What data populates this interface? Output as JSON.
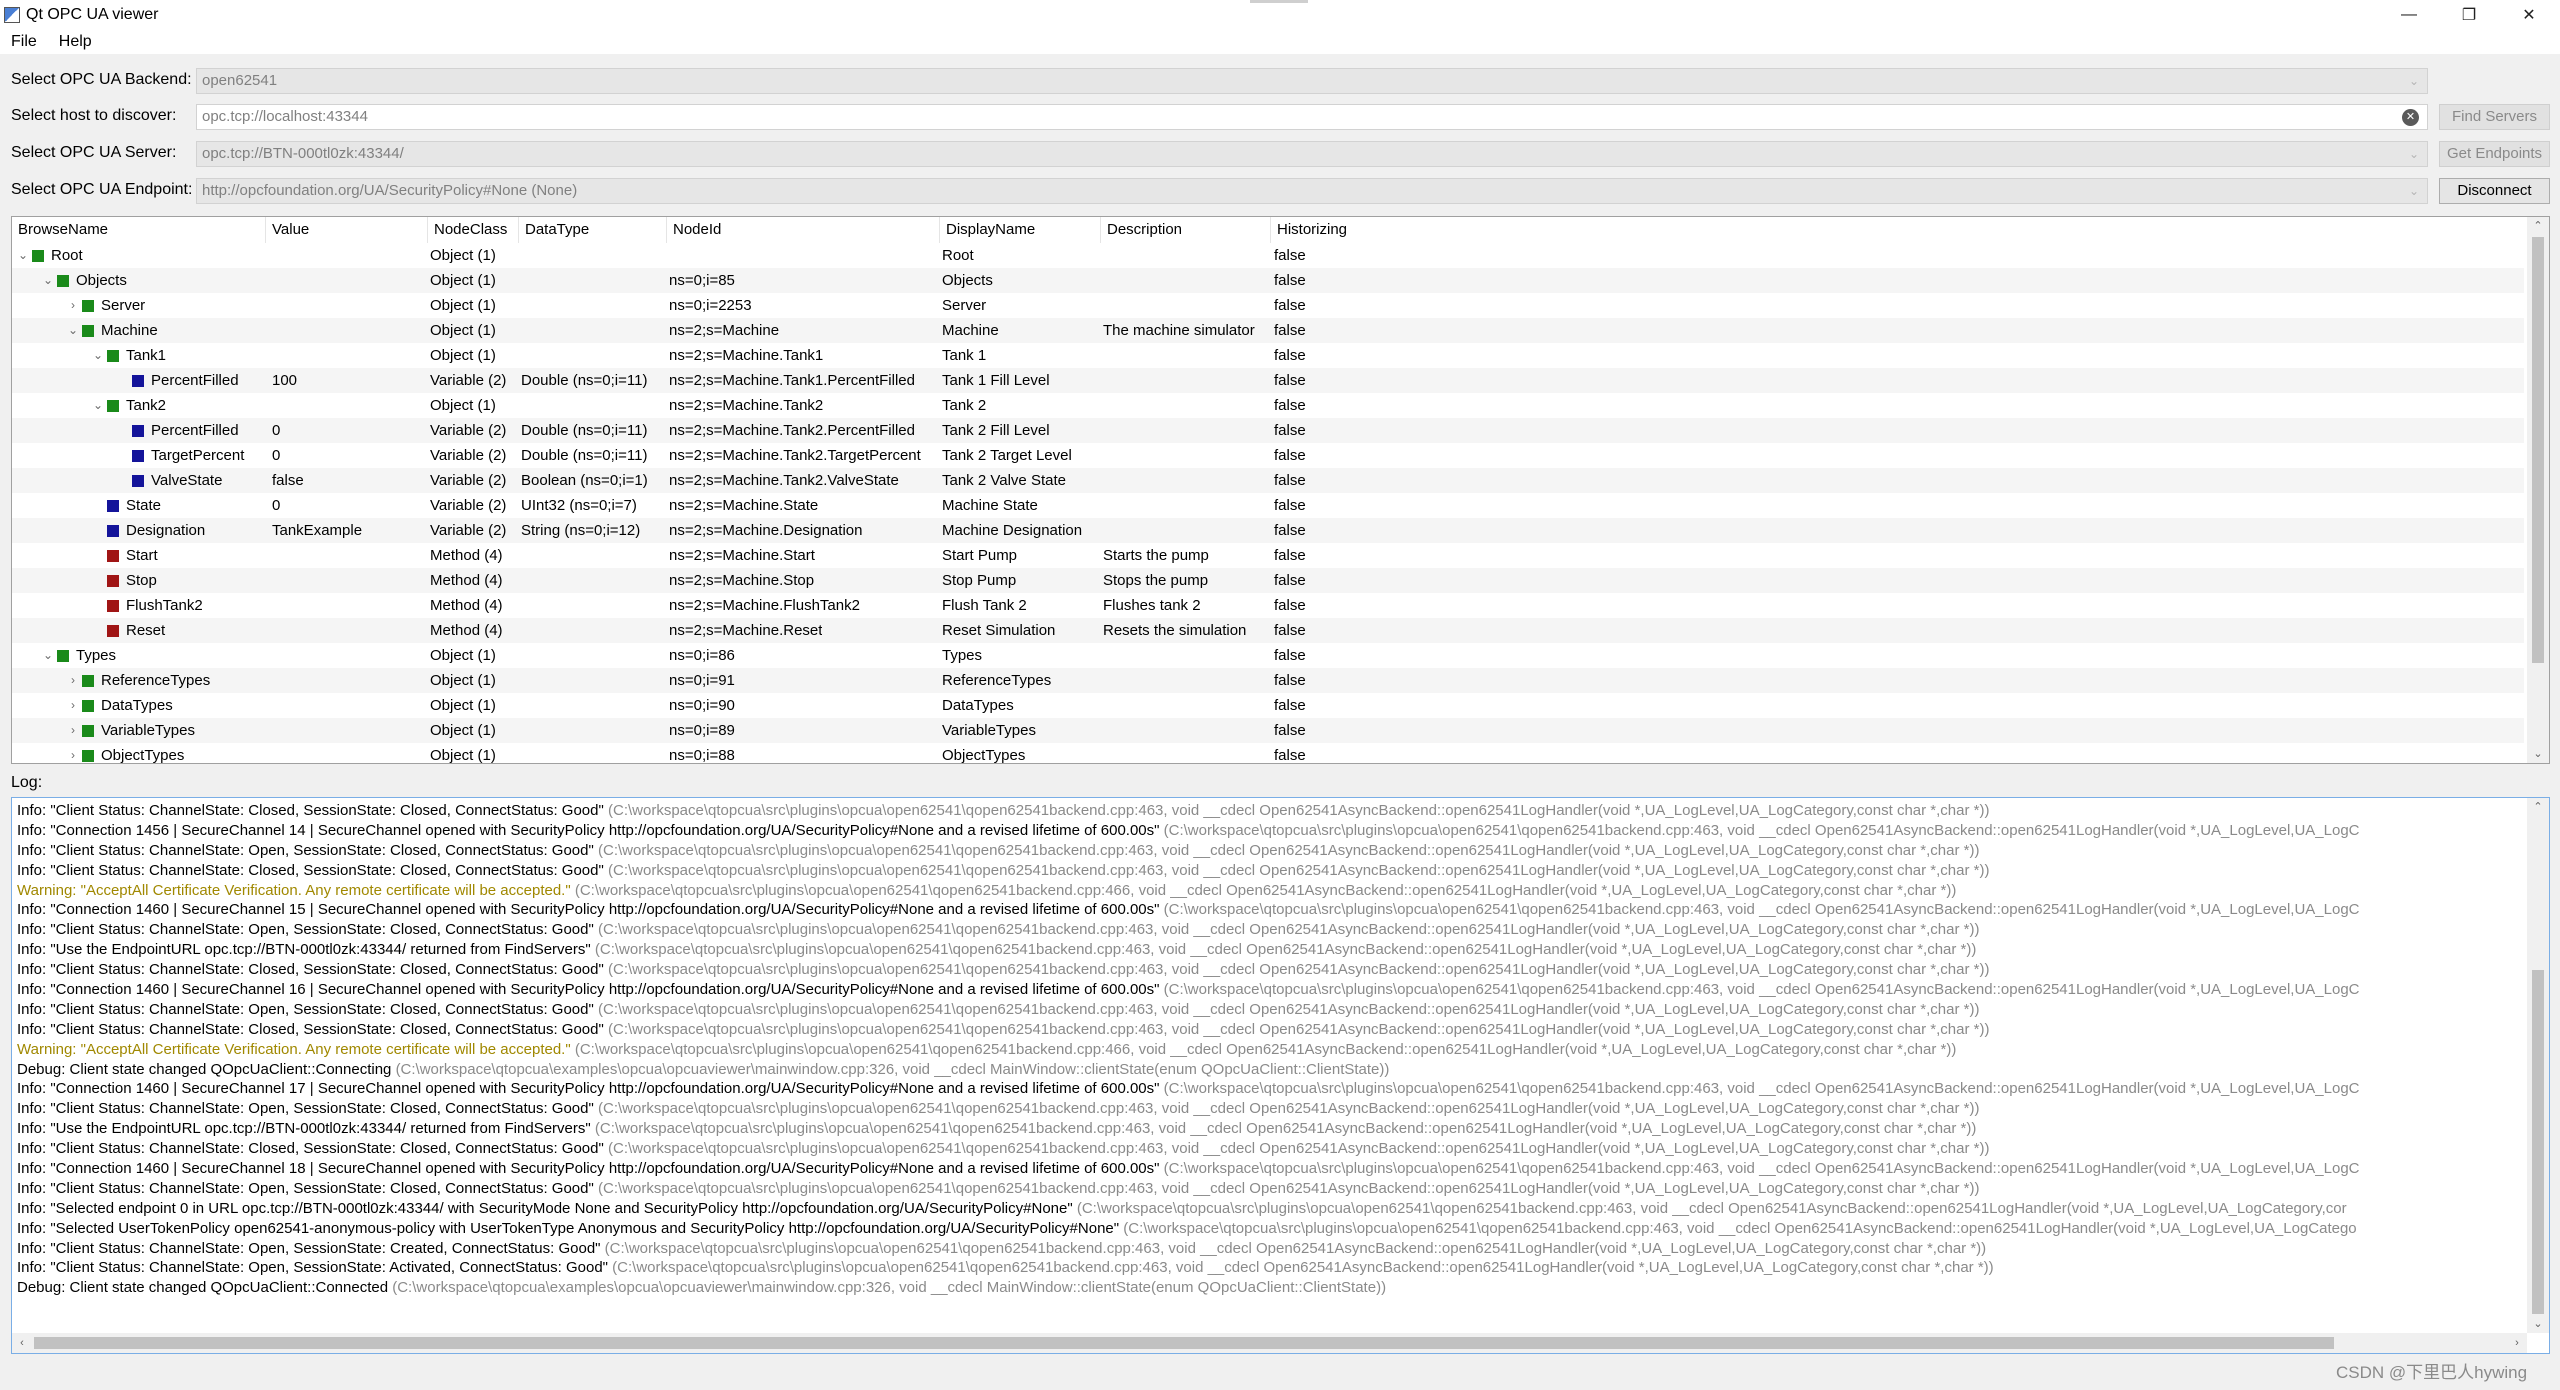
{
  "window": {
    "title": "Qt OPC UA viewer",
    "minimize": "—",
    "maximize": "❐",
    "close": "✕"
  },
  "menu": [
    "File",
    "Help"
  ],
  "form": {
    "backend_label": "Select OPC UA Backend:",
    "backend_value": "open62541",
    "host_label": "Select host to discover:",
    "host_value": "opc.tcp://localhost:43344",
    "find_servers": "Find Servers",
    "server_label": "Select OPC UA Server:",
    "server_value": "opc.tcp://BTN-000tl0zk:43344/",
    "get_endpoints": "Get Endpoints",
    "endpoint_label": "Select OPC UA Endpoint:",
    "endpoint_value": "http://opcfoundation.org/UA/SecurityPolicy#None (None)",
    "disconnect": "Disconnect"
  },
  "tree": {
    "headers": [
      "BrowseName",
      "Value",
      "NodeClass",
      "DataType",
      "NodeId",
      "DisplayName",
      "Description",
      "Historizing"
    ],
    "rows": [
      {
        "level": 0,
        "expander": "open",
        "icon": "green",
        "browse": "Root",
        "value": "",
        "nodeclass": "Object (1)",
        "datatype": "",
        "nodeid": "",
        "display": "Root",
        "desc": "",
        "hist": "false"
      },
      {
        "level": 1,
        "expander": "open",
        "icon": "green",
        "browse": "Objects",
        "value": "",
        "nodeclass": "Object (1)",
        "datatype": "",
        "nodeid": "ns=0;i=85",
        "display": "Objects",
        "desc": "",
        "hist": "false"
      },
      {
        "level": 2,
        "expander": "closed",
        "icon": "green",
        "browse": "Server",
        "value": "",
        "nodeclass": "Object (1)",
        "datatype": "",
        "nodeid": "ns=0;i=2253",
        "display": "Server",
        "desc": "",
        "hist": "false"
      },
      {
        "level": 2,
        "expander": "open",
        "icon": "green",
        "browse": "Machine",
        "value": "",
        "nodeclass": "Object (1)",
        "datatype": "",
        "nodeid": "ns=2;s=Machine",
        "display": "Machine",
        "desc": "The machine simulator",
        "hist": "false"
      },
      {
        "level": 3,
        "expander": "open",
        "icon": "green",
        "browse": "Tank1",
        "value": "",
        "nodeclass": "Object (1)",
        "datatype": "",
        "nodeid": "ns=2;s=Machine.Tank1",
        "display": "Tank 1",
        "desc": "",
        "hist": "false"
      },
      {
        "level": 4,
        "expander": "none",
        "icon": "blue",
        "browse": "PercentFilled",
        "value": "100",
        "nodeclass": "Variable (2)",
        "datatype": "Double (ns=0;i=11)",
        "nodeid": "ns=2;s=Machine.Tank1.PercentFilled",
        "display": "Tank 1 Fill Level",
        "desc": "",
        "hist": "false"
      },
      {
        "level": 3,
        "expander": "open",
        "icon": "green",
        "browse": "Tank2",
        "value": "",
        "nodeclass": "Object (1)",
        "datatype": "",
        "nodeid": "ns=2;s=Machine.Tank2",
        "display": "Tank 2",
        "desc": "",
        "hist": "false"
      },
      {
        "level": 4,
        "expander": "none",
        "icon": "blue",
        "browse": "PercentFilled",
        "value": "0",
        "nodeclass": "Variable (2)",
        "datatype": "Double (ns=0;i=11)",
        "nodeid": "ns=2;s=Machine.Tank2.PercentFilled",
        "display": "Tank 2 Fill Level",
        "desc": "",
        "hist": "false"
      },
      {
        "level": 4,
        "expander": "none",
        "icon": "blue",
        "browse": "TargetPercent",
        "value": "0",
        "nodeclass": "Variable (2)",
        "datatype": "Double (ns=0;i=11)",
        "nodeid": "ns=2;s=Machine.Tank2.TargetPercent",
        "display": "Tank 2 Target Level",
        "desc": "",
        "hist": "false"
      },
      {
        "level": 4,
        "expander": "none",
        "icon": "blue",
        "browse": "ValveState",
        "value": "false",
        "nodeclass": "Variable (2)",
        "datatype": "Boolean (ns=0;i=1)",
        "nodeid": "ns=2;s=Machine.Tank2.ValveState",
        "display": "Tank 2 Valve State",
        "desc": "",
        "hist": "false"
      },
      {
        "level": 3,
        "expander": "none",
        "icon": "blue",
        "browse": "State",
        "value": "0",
        "nodeclass": "Variable (2)",
        "datatype": "UInt32 (ns=0;i=7)",
        "nodeid": "ns=2;s=Machine.State",
        "display": "Machine State",
        "desc": "",
        "hist": "false"
      },
      {
        "level": 3,
        "expander": "none",
        "icon": "blue",
        "browse": "Designation",
        "value": "TankExample",
        "nodeclass": "Variable (2)",
        "datatype": "String (ns=0;i=12)",
        "nodeid": "ns=2;s=Machine.Designation",
        "display": "Machine Designation",
        "desc": "",
        "hist": "false"
      },
      {
        "level": 3,
        "expander": "none",
        "icon": "red",
        "browse": "Start",
        "value": "",
        "nodeclass": "Method (4)",
        "datatype": "",
        "nodeid": "ns=2;s=Machine.Start",
        "display": "Start Pump",
        "desc": "Starts the pump",
        "hist": "false"
      },
      {
        "level": 3,
        "expander": "none",
        "icon": "red",
        "browse": "Stop",
        "value": "",
        "nodeclass": "Method (4)",
        "datatype": "",
        "nodeid": "ns=2;s=Machine.Stop",
        "display": "Stop Pump",
        "desc": "Stops the pump",
        "hist": "false"
      },
      {
        "level": 3,
        "expander": "none",
        "icon": "red",
        "browse": "FlushTank2",
        "value": "",
        "nodeclass": "Method (4)",
        "datatype": "",
        "nodeid": "ns=2;s=Machine.FlushTank2",
        "display": "Flush Tank 2",
        "desc": "Flushes tank 2",
        "hist": "false"
      },
      {
        "level": 3,
        "expander": "none",
        "icon": "red",
        "browse": "Reset",
        "value": "",
        "nodeclass": "Method (4)",
        "datatype": "",
        "nodeid": "ns=2;s=Machine.Reset",
        "display": "Reset Simulation",
        "desc": "Resets the simulation",
        "hist": "false"
      },
      {
        "level": 1,
        "expander": "open",
        "icon": "green",
        "browse": "Types",
        "value": "",
        "nodeclass": "Object (1)",
        "datatype": "",
        "nodeid": "ns=0;i=86",
        "display": "Types",
        "desc": "",
        "hist": "false"
      },
      {
        "level": 2,
        "expander": "closed",
        "icon": "green",
        "browse": "ReferenceTypes",
        "value": "",
        "nodeclass": "Object (1)",
        "datatype": "",
        "nodeid": "ns=0;i=91",
        "display": "ReferenceTypes",
        "desc": "",
        "hist": "false"
      },
      {
        "level": 2,
        "expander": "closed",
        "icon": "green",
        "browse": "DataTypes",
        "value": "",
        "nodeclass": "Object (1)",
        "datatype": "",
        "nodeid": "ns=0;i=90",
        "display": "DataTypes",
        "desc": "",
        "hist": "false"
      },
      {
        "level": 2,
        "expander": "closed",
        "icon": "green",
        "browse": "VariableTypes",
        "value": "",
        "nodeclass": "Object (1)",
        "datatype": "",
        "nodeid": "ns=0;i=89",
        "display": "VariableTypes",
        "desc": "",
        "hist": "false"
      },
      {
        "level": 2,
        "expander": "closed",
        "icon": "green",
        "browse": "ObjectTypes",
        "value": "",
        "nodeclass": "Object (1)",
        "datatype": "",
        "nodeid": "ns=0;i=88",
        "display": "ObjectTypes",
        "desc": "",
        "hist": "false"
      }
    ]
  },
  "log": {
    "label": "Log:",
    "lines": [
      {
        "kind": "info",
        "msg": "Info: \"Client Status: ChannelState: Closed, SessionState: Closed, ConnectStatus: Good\"",
        "loc": "(C:\\workspace\\qtopcua\\src\\plugins\\opcua\\open62541\\qopen62541backend.cpp:463, void __cdecl Open62541AsyncBackend::open62541LogHandler(void *,UA_LogLevel,UA_LogCategory,const char *,char *))"
      },
      {
        "kind": "info",
        "msg": "Info: \"Connection 1456 | SecureChannel 14 | SecureChannel opened with SecurityPolicy http://opcfoundation.org/UA/SecurityPolicy#None and a revised lifetime of 600.00s\"",
        "loc": "(C:\\workspace\\qtopcua\\src\\plugins\\opcua\\open62541\\qopen62541backend.cpp:463, void __cdecl Open62541AsyncBackend::open62541LogHandler(void *,UA_LogLevel,UA_LogC"
      },
      {
        "kind": "info",
        "msg": "Info: \"Client Status: ChannelState: Open, SessionState: Closed, ConnectStatus: Good\"",
        "loc": "(C:\\workspace\\qtopcua\\src\\plugins\\opcua\\open62541\\qopen62541backend.cpp:463, void __cdecl Open62541AsyncBackend::open62541LogHandler(void *,UA_LogLevel,UA_LogCategory,const char *,char *))"
      },
      {
        "kind": "info",
        "msg": "Info: \"Client Status: ChannelState: Closed, SessionState: Closed, ConnectStatus: Good\"",
        "loc": "(C:\\workspace\\qtopcua\\src\\plugins\\opcua\\open62541\\qopen62541backend.cpp:463, void __cdecl Open62541AsyncBackend::open62541LogHandler(void *,UA_LogLevel,UA_LogCategory,const char *,char *))"
      },
      {
        "kind": "warning",
        "msg": "Warning: \"AcceptAll Certificate Verification. Any remote certificate will be accepted.\"",
        "loc": "(C:\\workspace\\qtopcua\\src\\plugins\\opcua\\open62541\\qopen62541backend.cpp:466, void __cdecl Open62541AsyncBackend::open62541LogHandler(void *,UA_LogLevel,UA_LogCategory,const char *,char *))"
      },
      {
        "kind": "info",
        "msg": "Info: \"Connection 1460 | SecureChannel 15 | SecureChannel opened with SecurityPolicy http://opcfoundation.org/UA/SecurityPolicy#None and a revised lifetime of 600.00s\"",
        "loc": "(C:\\workspace\\qtopcua\\src\\plugins\\opcua\\open62541\\qopen62541backend.cpp:463, void __cdecl Open62541AsyncBackend::open62541LogHandler(void *,UA_LogLevel,UA_LogC"
      },
      {
        "kind": "info",
        "msg": "Info: \"Client Status: ChannelState: Open, SessionState: Closed, ConnectStatus: Good\"",
        "loc": "(C:\\workspace\\qtopcua\\src\\plugins\\opcua\\open62541\\qopen62541backend.cpp:463, void __cdecl Open62541AsyncBackend::open62541LogHandler(void *,UA_LogLevel,UA_LogCategory,const char *,char *))"
      },
      {
        "kind": "info",
        "msg": "Info: \"Use the EndpointURL opc.tcp://BTN-000tl0zk:43344/ returned from FindServers\"",
        "loc": "(C:\\workspace\\qtopcua\\src\\plugins\\opcua\\open62541\\qopen62541backend.cpp:463, void __cdecl Open62541AsyncBackend::open62541LogHandler(void *,UA_LogLevel,UA_LogCategory,const char *,char *))"
      },
      {
        "kind": "info",
        "msg": "Info: \"Client Status: ChannelState: Closed, SessionState: Closed, ConnectStatus: Good\"",
        "loc": "(C:\\workspace\\qtopcua\\src\\plugins\\opcua\\open62541\\qopen62541backend.cpp:463, void __cdecl Open62541AsyncBackend::open62541LogHandler(void *,UA_LogLevel,UA_LogCategory,const char *,char *))"
      },
      {
        "kind": "info",
        "msg": "Info: \"Connection 1460 | SecureChannel 16 | SecureChannel opened with SecurityPolicy http://opcfoundation.org/UA/SecurityPolicy#None and a revised lifetime of 600.00s\"",
        "loc": "(C:\\workspace\\qtopcua\\src\\plugins\\opcua\\open62541\\qopen62541backend.cpp:463, void __cdecl Open62541AsyncBackend::open62541LogHandler(void *,UA_LogLevel,UA_LogC"
      },
      {
        "kind": "info",
        "msg": "Info: \"Client Status: ChannelState: Open, SessionState: Closed, ConnectStatus: Good\"",
        "loc": "(C:\\workspace\\qtopcua\\src\\plugins\\opcua\\open62541\\qopen62541backend.cpp:463, void __cdecl Open62541AsyncBackend::open62541LogHandler(void *,UA_LogLevel,UA_LogCategory,const char *,char *))"
      },
      {
        "kind": "info",
        "msg": "Info: \"Client Status: ChannelState: Closed, SessionState: Closed, ConnectStatus: Good\"",
        "loc": "(C:\\workspace\\qtopcua\\src\\plugins\\opcua\\open62541\\qopen62541backend.cpp:463, void __cdecl Open62541AsyncBackend::open62541LogHandler(void *,UA_LogLevel,UA_LogCategory,const char *,char *))"
      },
      {
        "kind": "warning",
        "msg": "Warning: \"AcceptAll Certificate Verification. Any remote certificate will be accepted.\"",
        "loc": "(C:\\workspace\\qtopcua\\src\\plugins\\opcua\\open62541\\qopen62541backend.cpp:466, void __cdecl Open62541AsyncBackend::open62541LogHandler(void *,UA_LogLevel,UA_LogCategory,const char *,char *))"
      },
      {
        "kind": "debug",
        "msg": "Debug: Client state changed QOpcUaClient::Connecting",
        "loc": "(C:\\workspace\\qtopcua\\examples\\opcua\\opcuaviewer\\mainwindow.cpp:326, void __cdecl MainWindow::clientState(enum QOpcUaClient::ClientState))"
      },
      {
        "kind": "info",
        "msg": "Info: \"Connection 1460 | SecureChannel 17 | SecureChannel opened with SecurityPolicy http://opcfoundation.org/UA/SecurityPolicy#None and a revised lifetime of 600.00s\"",
        "loc": "(C:\\workspace\\qtopcua\\src\\plugins\\opcua\\open62541\\qopen62541backend.cpp:463, void __cdecl Open62541AsyncBackend::open62541LogHandler(void *,UA_LogLevel,UA_LogC"
      },
      {
        "kind": "info",
        "msg": "Info: \"Client Status: ChannelState: Open, SessionState: Closed, ConnectStatus: Good\"",
        "loc": "(C:\\workspace\\qtopcua\\src\\plugins\\opcua\\open62541\\qopen62541backend.cpp:463, void __cdecl Open62541AsyncBackend::open62541LogHandler(void *,UA_LogLevel,UA_LogCategory,const char *,char *))"
      },
      {
        "kind": "info",
        "msg": "Info: \"Use the EndpointURL opc.tcp://BTN-000tl0zk:43344/ returned from FindServers\"",
        "loc": "(C:\\workspace\\qtopcua\\src\\plugins\\opcua\\open62541\\qopen62541backend.cpp:463, void __cdecl Open62541AsyncBackend::open62541LogHandler(void *,UA_LogLevel,UA_LogCategory,const char *,char *))"
      },
      {
        "kind": "info",
        "msg": "Info: \"Client Status: ChannelState: Closed, SessionState: Closed, ConnectStatus: Good\"",
        "loc": "(C:\\workspace\\qtopcua\\src\\plugins\\opcua\\open62541\\qopen62541backend.cpp:463, void __cdecl Open62541AsyncBackend::open62541LogHandler(void *,UA_LogLevel,UA_LogCategory,const char *,char *))"
      },
      {
        "kind": "info",
        "msg": "Info: \"Connection 1460 | SecureChannel 18 | SecureChannel opened with SecurityPolicy http://opcfoundation.org/UA/SecurityPolicy#None and a revised lifetime of 600.00s\"",
        "loc": "(C:\\workspace\\qtopcua\\src\\plugins\\opcua\\open62541\\qopen62541backend.cpp:463, void __cdecl Open62541AsyncBackend::open62541LogHandler(void *,UA_LogLevel,UA_LogC"
      },
      {
        "kind": "info",
        "msg": "Info: \"Client Status: ChannelState: Open, SessionState: Closed, ConnectStatus: Good\"",
        "loc": "(C:\\workspace\\qtopcua\\src\\plugins\\opcua\\open62541\\qopen62541backend.cpp:463, void __cdecl Open62541AsyncBackend::open62541LogHandler(void *,UA_LogLevel,UA_LogCategory,const char *,char *))"
      },
      {
        "kind": "info",
        "msg": "Info: \"Selected endpoint 0 in URL opc.tcp://BTN-000tl0zk:43344/ with SecurityMode None and SecurityPolicy http://opcfoundation.org/UA/SecurityPolicy#None\"",
        "loc": "(C:\\workspace\\qtopcua\\src\\plugins\\opcua\\open62541\\qopen62541backend.cpp:463, void __cdecl Open62541AsyncBackend::open62541LogHandler(void *,UA_LogLevel,UA_LogCategory,cor"
      },
      {
        "kind": "info",
        "msg": "Info: \"Selected UserTokenPolicy open62541-anonymous-policy with UserTokenType Anonymous and SecurityPolicy http://opcfoundation.org/UA/SecurityPolicy#None\"",
        "loc": "(C:\\workspace\\qtopcua\\src\\plugins\\opcua\\open62541\\qopen62541backend.cpp:463, void __cdecl Open62541AsyncBackend::open62541LogHandler(void *,UA_LogLevel,UA_LogCatego"
      },
      {
        "kind": "info",
        "msg": "Info: \"Client Status: ChannelState: Open, SessionState: Created, ConnectStatus: Good\"",
        "loc": "(C:\\workspace\\qtopcua\\src\\plugins\\opcua\\open62541\\qopen62541backend.cpp:463, void __cdecl Open62541AsyncBackend::open62541LogHandler(void *,UA_LogLevel,UA_LogCategory,const char *,char *))"
      },
      {
        "kind": "info",
        "msg": "Info: \"Client Status: ChannelState: Open, SessionState: Activated, ConnectStatus: Good\"",
        "loc": "(C:\\workspace\\qtopcua\\src\\plugins\\opcua\\open62541\\qopen62541backend.cpp:463, void __cdecl Open62541AsyncBackend::open62541LogHandler(void *,UA_LogLevel,UA_LogCategory,const char *,char *))"
      },
      {
        "kind": "debug",
        "msg": "Debug: Client state changed QOpcUaClient::Connected",
        "loc": "(C:\\workspace\\qtopcua\\examples\\opcua\\opcuaviewer\\mainwindow.cpp:326, void __cdecl MainWindow::clientState(enum QOpcUaClient::ClientState))"
      }
    ]
  },
  "watermark": "CSDN @下里巴人hywing",
  "colors": {
    "node_object": "#1a8a1a",
    "node_variable": "#14149a",
    "node_method": "#a01515",
    "warning_text": "#a08800",
    "log_location_text": "#8a8a8a"
  }
}
